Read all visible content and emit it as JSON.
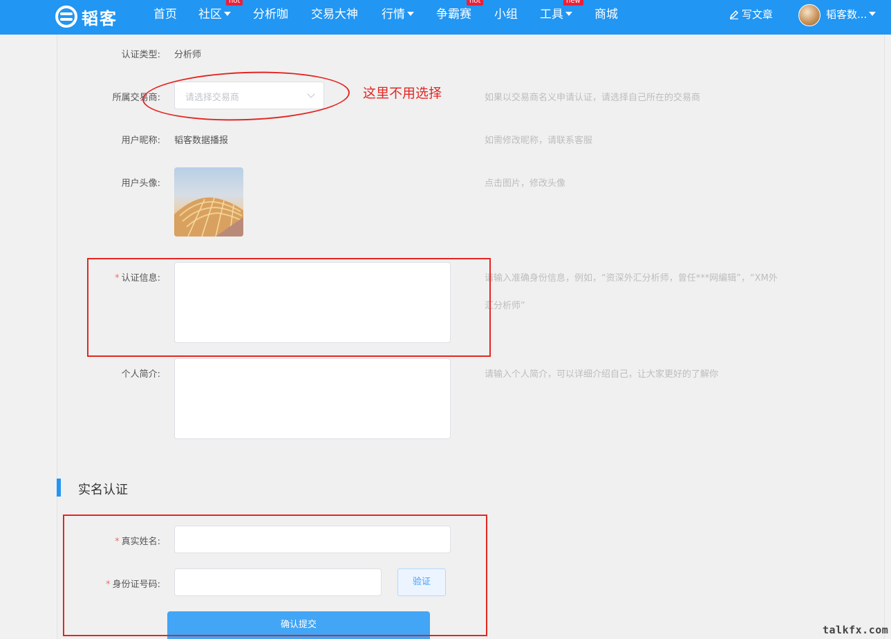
{
  "header": {
    "logo_text": "韬客",
    "nav": [
      {
        "label": "首页",
        "badge": "",
        "dropdown": false
      },
      {
        "label": "社区",
        "badge": "hot",
        "dropdown": true
      },
      {
        "label": "分析咖",
        "badge": "",
        "dropdown": false
      },
      {
        "label": "交易大神",
        "badge": "",
        "dropdown": false
      },
      {
        "label": "行情",
        "badge": "",
        "dropdown": true
      },
      {
        "label": "争霸赛",
        "badge": "hot",
        "dropdown": false
      },
      {
        "label": "小组",
        "badge": "",
        "dropdown": false
      },
      {
        "label": "工具",
        "badge": "new",
        "dropdown": true
      },
      {
        "label": "商城",
        "badge": "",
        "dropdown": false
      }
    ],
    "write_label": "写文章",
    "user_name": "韬客数..."
  },
  "form": {
    "cert_type": {
      "label": "认证类型:",
      "value": "分析师"
    },
    "broker": {
      "label": "所属交易商:",
      "placeholder": "请选择交易商",
      "hint": "如果以交易商名义申请认证，请选择自己所在的交易商"
    },
    "nickname": {
      "label": "用户昵称:",
      "value": "韬客数据播报",
      "hint": "如需修改昵称，请联系客服"
    },
    "avatar": {
      "label": "用户头像:",
      "hint": "点击图片，修改头像"
    },
    "cert_info": {
      "label": "认证信息:",
      "required_mark": "*",
      "hint_line1": "请输入准确身份信息，例如，“资深外汇分析师，曾任***网编辑”，“XM外",
      "hint_line2": "汇分析师”"
    },
    "bio": {
      "label": "个人简介:",
      "hint": "请输入个人简介，可以详细介绍自己，让大家更好的了解你"
    }
  },
  "realname": {
    "section_title": "实名认证",
    "name": {
      "label": "真实姓名:",
      "required_mark": "*"
    },
    "id_number": {
      "label": "身份证号码:",
      "required_mark": "*"
    },
    "verify_label": "验证",
    "submit_label": "确认提交"
  },
  "annotation": {
    "note": "这里不用选择"
  },
  "watermark": "talkfx.com",
  "colors": {
    "primary": "#2196f3",
    "annotation": "#e42521",
    "badge": "#e8213a"
  }
}
